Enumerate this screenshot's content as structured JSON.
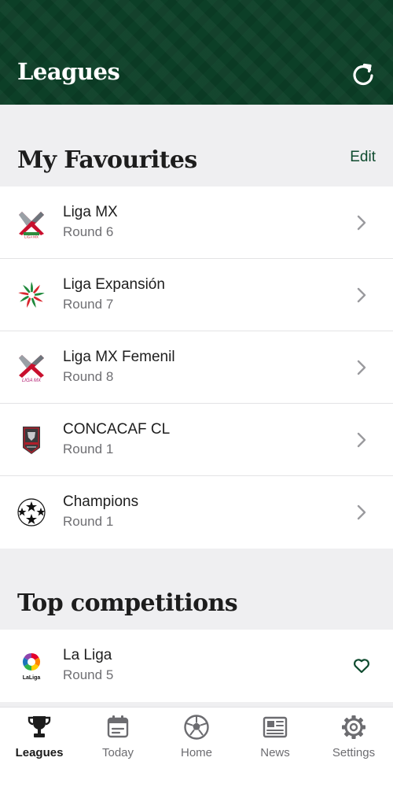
{
  "header": {
    "title": "Leagues",
    "refresh_icon": "refresh-icon"
  },
  "favourites": {
    "title": "My Favourites",
    "edit_label": "Edit",
    "items": [
      {
        "name": "Liga MX",
        "round": "Round 6",
        "logo": "liga-mx-logo"
      },
      {
        "name": "Liga Expansión",
        "round": "Round 7",
        "logo": "liga-expansion-logo"
      },
      {
        "name": "Liga MX Femenil",
        "round": "Round 8",
        "logo": "liga-mx-femenil-logo"
      },
      {
        "name": "CONCACAF CL",
        "round": "Round 1",
        "logo": "concacaf-cl-logo"
      },
      {
        "name": "Champions",
        "round": "Round 1",
        "logo": "champions-league-logo"
      }
    ]
  },
  "top": {
    "title": "Top competitions",
    "items": [
      {
        "name": "La Liga",
        "round": "Round 5",
        "logo": "la-liga-logo"
      }
    ]
  },
  "tabs": [
    {
      "label": "Leagues",
      "icon": "trophy-icon",
      "active": true
    },
    {
      "label": "Today",
      "icon": "calendar-icon",
      "active": false
    },
    {
      "label": "Home",
      "icon": "soccer-ball-icon",
      "active": false
    },
    {
      "label": "News",
      "icon": "newspaper-icon",
      "active": false
    },
    {
      "label": "Settings",
      "icon": "gear-icon",
      "active": false
    }
  ],
  "colors": {
    "header_bg": "#0c3f27",
    "accent": "#0f4b2f",
    "page_bg": "#efeff1"
  }
}
